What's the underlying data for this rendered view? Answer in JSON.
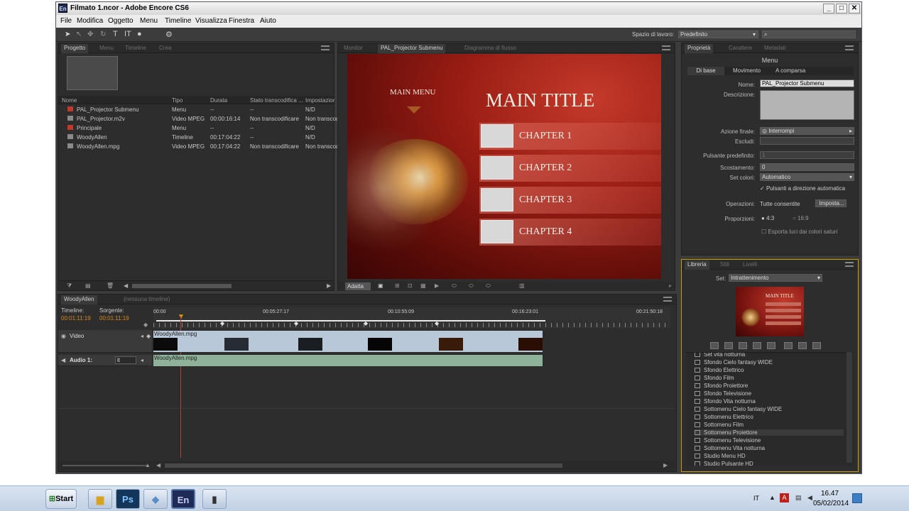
{
  "window": {
    "title": "Filmato 1.ncor - Adobe Encore CS6",
    "app_icon": "En",
    "controls": [
      "_",
      "□",
      "✕"
    ]
  },
  "menu": [
    "File",
    "Modifica",
    "Oggetto",
    "Menu",
    "Timeline",
    "Visualizza",
    "Finestra",
    "Aiuto"
  ],
  "toolbar": {
    "workspace_label": "Spazio di lavoro:",
    "workspace_value": "Predefinito",
    "search_placeholder": ""
  },
  "project_panel": {
    "tabs": [
      "Progetto",
      "Menu",
      "Timeline",
      "Crea"
    ],
    "columns": [
      "Nome",
      "Tipo",
      "Durata",
      "Stato transcodifica ...",
      "Impostazior"
    ],
    "rows": [
      {
        "name": "PAL_Projector Submenu",
        "type": "Menu",
        "duration": "--",
        "status": "--",
        "settings": "N/D"
      },
      {
        "name": "PAL_Projector.m2v",
        "type": "Video MPEG",
        "duration": "00:00:16:14",
        "status": "Non transcodificare",
        "settings": "Non transcod"
      },
      {
        "name": "Principale",
        "type": "Menu",
        "duration": "--",
        "status": "--",
        "settings": "N/D"
      },
      {
        "name": "WoodyAllen",
        "type": "Timeline",
        "duration": "00:17:04:22",
        "status": "--",
        "settings": "N/D"
      },
      {
        "name": "WoodyAllen.mpg",
        "type": "Video MPEG",
        "duration": "00:17:04:22",
        "status": "Non transcodificare",
        "settings": "Non transcod"
      }
    ]
  },
  "monitor_panel": {
    "tabs": [
      "Monitor",
      "PAL_Projector Submenu",
      "Diagramma di flusso"
    ],
    "menu_label": "MAIN MENU",
    "main_title": "MAIN TITLE",
    "chapters": [
      "CHAPTER 1",
      "CHAPTER 2",
      "CHAPTER 3",
      "CHAPTER 4"
    ],
    "fit_label": "Adatta"
  },
  "properties_panel": {
    "tabs": [
      "Proprietà",
      "Carattere",
      "Metadati"
    ],
    "section": "Menu",
    "subtabs": [
      "Di base",
      "Movimento",
      "A comparsa"
    ],
    "name_label": "Nome:",
    "name_value": "PAL_Projector Submenu",
    "desc_label": "Descrizione:",
    "end_action_label": "Azione finale:",
    "end_action_value": "Interrompi",
    "exclude_label": "Escludi:",
    "default_button_label": "Pulsante predefinito:",
    "default_button_value": "1",
    "offset_label": "Scostamento:",
    "offset_value": "0",
    "colorset_label": "Set colori:",
    "colorset_value": "Automatico",
    "auto_routing": "Pulsanti a direzione automatica",
    "operations_label": "Operazioni:",
    "operations_value": "Tutte consentite",
    "operations_button": "Imposta...",
    "aspect_label": "Proporzioni:",
    "aspect_43": "4:3",
    "aspect_169": "16:9",
    "export_colors": "Esporta luci dai colori saturi"
  },
  "library_panel": {
    "tabs": [
      "Libreria",
      "Stili",
      "Livelli"
    ],
    "set_label": "Set:",
    "set_value": "Intrattenimento",
    "preview_title": "MAIN TITLE",
    "items": [
      "Set vita notturna",
      "Sfondo Cielo fantasy WIDE",
      "Sfondo Elettrico",
      "Sfondo Film",
      "Sfondo Proiettore",
      "Sfondo Televisione",
      "Sfondo Vita notturna",
      "Sottomenu Cielo fantasy WIDE",
      "Sottomenu Elettrico",
      "Sottomenu Film",
      "Sottomenu Proiettore",
      "Sottomenu Televisione",
      "Sottomenu Vita notturna",
      "Studio Menu HD",
      "Studio Pulsante HD"
    ]
  },
  "timeline_panel": {
    "tabs": [
      "WoodyAllen",
      "(nessuna timeline)"
    ],
    "timeline_label": "Timeline:",
    "source_label": "Sorgente:",
    "timeline_tc": "00:01:11:19",
    "source_tc": "00:01:11:19",
    "ruler": [
      "00:00",
      "00:05:27:17",
      "00:10:55:09",
      "00:16:23:01",
      "00:21:50:18"
    ],
    "video_track": "Video",
    "audio_track": "Audio 1:",
    "audio_sel": "it",
    "clip_video": "WoodyAllen.mpg",
    "clip_audio": "WoodyAllen.mpg"
  },
  "taskbar": {
    "start": "Start",
    "lang": "IT",
    "time": "16.47",
    "date": "05/02/2014"
  },
  "colors": {
    "accent_orange": "#d88a1e",
    "clip_video": "#b9c8d8",
    "clip_audio": "#8fb29a"
  }
}
